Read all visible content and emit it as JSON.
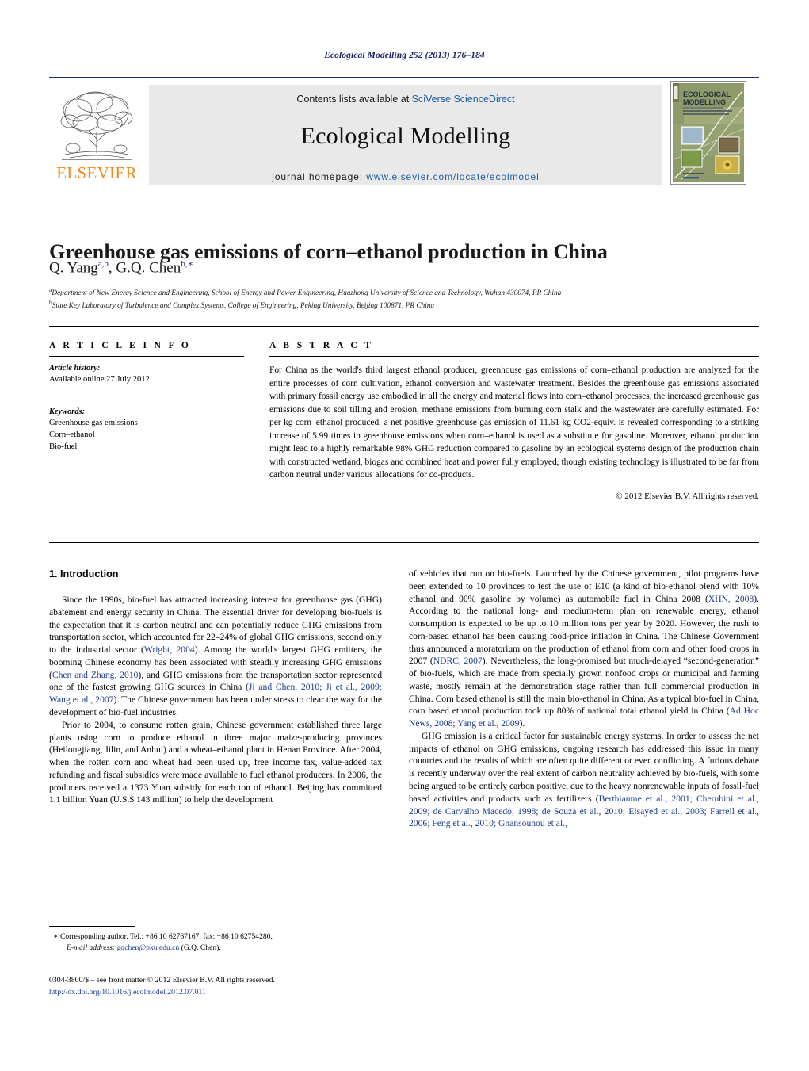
{
  "running_head": "Ecological Modelling 252 (2013) 176–184",
  "masthead": {
    "publisher_logo_text": "ELSEVIER",
    "contents_prefix": "Contents lists available at ",
    "contents_link": "SciVerse ScienceDirect",
    "journal_name": "Ecological Modelling",
    "homepage_prefix": "journal homepage:",
    "homepage_url": "www.elsevier.com/locate/ecolmodel",
    "cover_title_line1": "ECOLOGICAL",
    "cover_title_line2": "MODELLING"
  },
  "article": {
    "title": "Greenhouse gas emissions of corn–ethanol production in China",
    "authors": "Q. Yang",
    "authors_sup_1": "a,b",
    "authors_2": ", G.Q. Chen",
    "authors_sup_2": "b,∗",
    "affiliation_a_marker": "a",
    "affiliation_a": "Department of New Energy Science and Engineering, School of Energy and Power Engineering, Huazhong University of Science and Technology, Wuhan 430074, PR China",
    "affiliation_b_marker": "b",
    "affiliation_b": "State Key Laboratory of Turbulence and Complex Systems, College of Engineering, Peking University, Beijing 100871, PR China"
  },
  "article_info": {
    "heading": "A R T I C L E  I N F O",
    "history_label": "Article history:",
    "history_value": "Available online 27 July 2012",
    "keywords_label": "Keywords:",
    "keywords": [
      "Greenhouse gas emissions",
      "Corn–ethanol",
      "Bio-fuel"
    ]
  },
  "abstract": {
    "heading": "A B S T R A C T",
    "text": "For China as the world's third largest ethanol producer, greenhouse gas emissions of corn–ethanol production are analyzed for the entire processes of corn cultivation, ethanol conversion and wastewater treatment. Besides the greenhouse gas emissions associated with primary fossil energy use embodied in all the energy and material flows into corn–ethanol processes, the increased greenhouse gas emissions due to soil tilling and erosion, methane emissions from burning corn stalk and the wastewater are carefully estimated. For per kg corn–ethanol produced, a net positive greenhouse gas emission of 11.61 kg CO2-equiv. is revealed corresponding to a striking increase of 5.99 times in greenhouse emissions when corn–ethanol is used as a substitute for gasoline. Moreover, ethanol production might lead to a highly remarkable 98% GHG reduction compared to gasoline by an ecological systems design of the production chain with constructed wetland, biogas and combined heat and power fully employed, though existing technology is illustrated to be far from carbon neutral under various allocations for co-products.",
    "copyright": "© 2012 Elsevier B.V. All rights reserved."
  },
  "body": {
    "section_number_title": "1.  Introduction",
    "left_paragraph_1_a": "Since the 1990s, bio-fuel has attracted increasing interest for greenhouse gas (GHG) abatement and energy security in China. The essential driver for developing bio-fuels is the expectation that it is carbon neutral and can potentially reduce GHG emissions from transportation sector, which accounted for 22–24% of global GHG emissions, second only to the industrial sector (",
    "cite_wright": "Wright, 2004",
    "left_paragraph_1_b": "). Among the world's largest GHG emitters, the booming Chinese economy has been associated with steadily increasing GHG emissions (",
    "cite_chen_zhang": "Chen and Zhang, 2010",
    "left_paragraph_1_c": "), and GHG emissions from the transportation sector represented one of the fastest growing GHG sources in China (",
    "cite_ji": "Ji and Chen, 2010; Ji et al., 2009; Wang et al., 2007",
    "left_paragraph_1_d": "). The Chinese government has been under stress to clear the way for the development of bio-fuel industries.",
    "left_paragraph_2": "Prior to 2004, to consume rotten grain, Chinese government established three large plants using corn to produce ethanol in three major maize-producing provinces (Heilongjiang, Jilin, and Anhui) and a wheat–ethanol plant in Henan Province. After 2004, when the rotten corn and wheat had been used up, free income tax, value-added tax refunding and fiscal subsidies were made available to fuel ethanol producers. In 2006, the producers received a 1373 Yuan subsidy for each ton of ethanol. Beijing has committed 1.1 billion Yuan (U.S.$ 143 million) to help the development",
    "right_paragraph_1_a": "of vehicles that run on bio-fuels. Launched by the Chinese government, pilot programs have been extended to 10 provinces to test the use of E10 (a kind of bio-ethanol blend with 10% ethanol and 90% gasoline by volume) as automobile fuel in China 2008 (",
    "cite_xhn": "XHN, 2008",
    "right_paragraph_1_b": "). According to the national long- and medium-term plan on renewable energy, ethanol consumption is expected to be up to 10 million tons per year by 2020. However, the rush to corn-based ethanol has been causing food-price inflation in China. The Chinese Government thus announced a moratorium on the production of ethanol from corn and other food crops in 2007 (",
    "cite_ndrc": "NDRC, 2007",
    "right_paragraph_1_c": "). Nevertheless, the long-promised but much-delayed “second-generation” of bio-fuels, which are made from specially grown nonfood crops or municipal and farming waste, mostly remain at the demonstration stage rather than full commercial production in China. Corn based ethanol is still the main bio-ethanol in China. As a typical bio-fuel in China, corn based ethanol production took up 80% of national total ethanol yield in China (",
    "cite_adhoc": "Ad Hoc News, 2008; Yang et al., 2009",
    "right_paragraph_1_d": ").",
    "right_paragraph_2_a": "GHG emission is a critical factor for sustainable energy systems. In order to assess the net impacts of ethanol on GHG emissions, ongoing research has addressed this issue in many countries and the results of which are often quite different or even conflicting. A furious debate is recently underway over the real extent of carbon neutrality achieved by bio-fuels, with some being argued to be entirely carbon positive, due to the heavy nonrenewable inputs of fossil-fuel based activities and products such as fertilizers (",
    "cite_long": "Berthiaume et al., 2001; Cherubini et al., 2009; de Carvalho Macedo, 1998; de Souza et al., 2010; Elsayed et al., 2003; Farrell et al., 2006; Feng et al., 2010; Gnansounou et al.,"
  },
  "footnotes": {
    "corresponding_marker": "∗",
    "corresponding_text": "Corresponding author. Tel.: +86 10 62767167; fax: +86 10 62754280.",
    "email_label": "E-mail address:",
    "email_value": "gqchen@pku.edu.cn",
    "email_owner": "(G.Q. Chen).",
    "issn_line": "0304-3800/$ – see front matter © 2012 Elsevier B.V. All rights reserved.",
    "doi_line": "http://dx.doi.org/10.1016/j.ecolmodel.2012.07.011"
  },
  "colors": {
    "link_blue": "#1f5fa8",
    "citation_blue": "#1b3a8f",
    "runhead_navy": "#18216b",
    "elsevier_orange": "#f08a1c",
    "masthead_grey": "#e9e9e9",
    "cover_olive": "#8f9a6b"
  }
}
